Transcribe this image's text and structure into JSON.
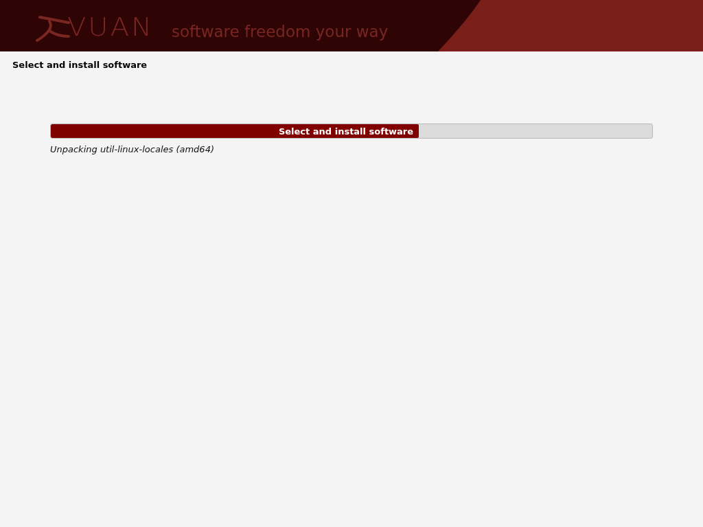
{
  "banner": {
    "logo_text": "VUAN",
    "tagline": "software freedom your way"
  },
  "title": "Select and install software",
  "progress": {
    "label": "Select and install software",
    "level": 0.612,
    "status": "Unpacking util-linux-locales (amd64)"
  }
}
